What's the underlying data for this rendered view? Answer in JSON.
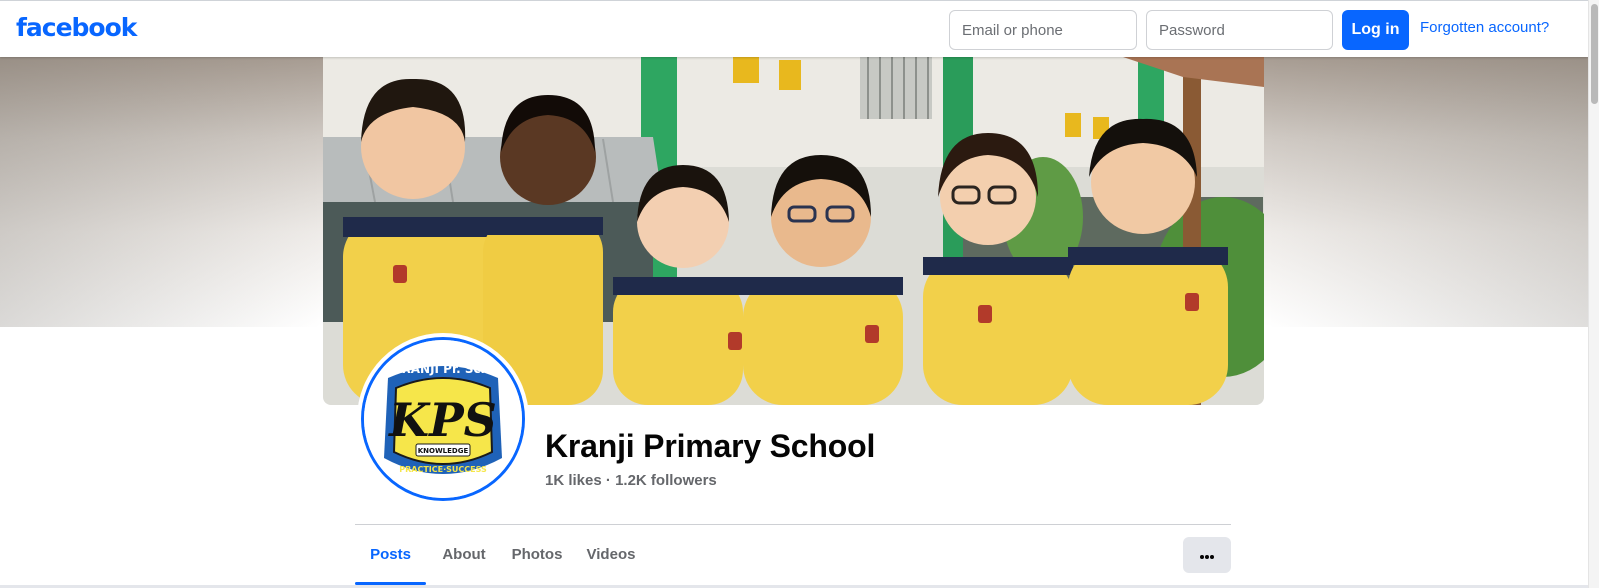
{
  "header": {
    "logo_text": "facebook",
    "email_placeholder": "Email or phone",
    "password_placeholder": "Password",
    "login_label": "Log in",
    "forgot_label": "Forgotten account?"
  },
  "colors": {
    "brand": "#0866ff",
    "text_secondary": "#65676b",
    "button_gray": "#e4e6eb"
  },
  "profile": {
    "name": "Kranji Primary School",
    "likes": "1K likes",
    "separator": "·",
    "followers": "1.2K followers",
    "logo_text": {
      "top": "KRANJI Pr. Sch.",
      "monogram": "KPS",
      "banner": "KNOWLEDGE",
      "bottom": "PRACTICE·SUCCESS"
    }
  },
  "tabs": [
    {
      "label": "Posts",
      "active": true
    },
    {
      "label": "About",
      "active": false
    },
    {
      "label": "Photos",
      "active": false
    },
    {
      "label": "Videos",
      "active": false
    }
  ],
  "more_button_icon": "more-horizontal-icon"
}
